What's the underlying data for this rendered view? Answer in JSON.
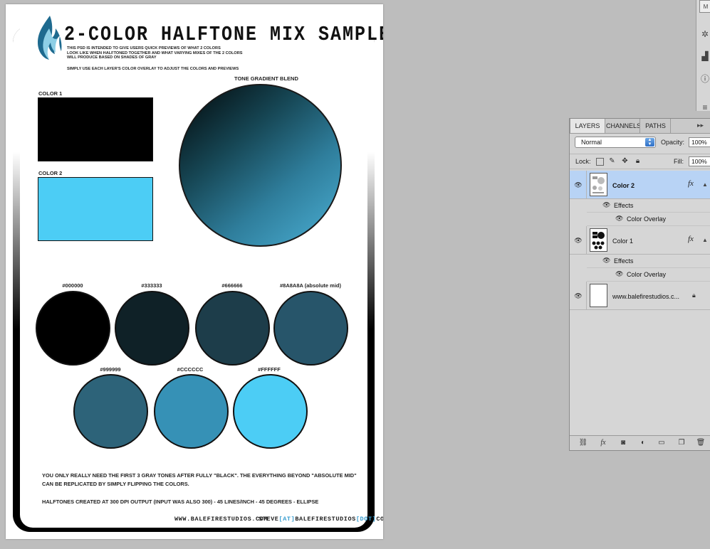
{
  "document": {
    "title": "2-COLOR HALFTONE MIX SAMPLER",
    "intro_lines": [
      "THIS PSD IS INTENDED TO GIVE USERS QUICK PREVIEWS OF WHAT 2 COLORS",
      "LOOK LIKE WHEN HALFTONED TOGETHER AND WHAT VARYING MIXES OF THE 2 COLORS",
      "WILL PRODUCE BASED ON SHADES OF GRAY"
    ],
    "intro_instruction": "SIMPLY USE EACH LAYER'S COLOR OVERLAY TO ADJUST THE COLORS AND PREVIEWS",
    "color1_label": "COLOR 1",
    "color2_label": "COLOR 2",
    "color1_hex": "#000000",
    "color2_hex": "#4ccdf5",
    "gradient_label": "TONE GRADIENT BLEND",
    "tones": [
      {
        "label": "#000000",
        "fill": "#000000"
      },
      {
        "label": "#333333",
        "fill": "#0f2127"
      },
      {
        "label": "#666666",
        "fill": "#1d3d4a"
      },
      {
        "label": "#8A8A8A (absolute mid)",
        "fill": "#27556a"
      },
      {
        "label": "#999999",
        "fill": "#2d6379"
      },
      {
        "label": "#CCCCCC",
        "fill": "#3691b6"
      },
      {
        "label": "#FFFFFF",
        "fill": "#4ccdf5"
      }
    ],
    "footer_line1": "YOU ONLY REALLY NEED THE FIRST 3 GRAY TONES AFTER FULLY \"BLACK\".  THE EVERYTHING BEYOND \"ABSOLUTE MID\"",
    "footer_line2": "CAN BE REPLICATED BY SIMPLY FLIPPING THE COLORS.",
    "footer_line3": "HALFTONES CREATED AT 300 DPI OUTPUT (INPUT WAS ALSO 300) - 45 LINES/INCH - 45 DEGREES - ELLIPSE",
    "website": "WWW.BALEFIRESTUDIOS.COM",
    "email_parts": [
      "STEVE",
      "[AT]",
      "BALEFIRESTUDIOS",
      "[DOT]",
      "COM"
    ]
  },
  "tool_strip": {
    "icons": [
      "mini-bridge-icon",
      "navigator-icon",
      "histogram-icon",
      "info-icon",
      "actions-icon"
    ],
    "top_label": "M"
  },
  "layers_panel": {
    "tabs": [
      "LAYERS",
      "CHANNELS",
      "PATHS"
    ],
    "blend_mode": "Normal",
    "opacity_label": "Opacity:",
    "opacity_value": "100%",
    "lock_label": "Lock:",
    "fill_label": "Fill:",
    "fill_value": "100%",
    "layers": [
      {
        "name": "Color 2",
        "effects_label": "Effects",
        "effect": "Color Overlay",
        "selected": true
      },
      {
        "name": "Color 1",
        "effects_label": "Effects",
        "effect": "Color Overlay",
        "selected": false
      },
      {
        "name": "www.balefirestudios.c...",
        "locked": true
      }
    ],
    "fx_label": "fx",
    "bottom_icons": [
      "link-layers-icon",
      "fx-icon",
      "add-mask-icon",
      "adjustment-layer-icon",
      "new-group-icon",
      "new-layer-icon",
      "delete-layer-icon"
    ]
  }
}
